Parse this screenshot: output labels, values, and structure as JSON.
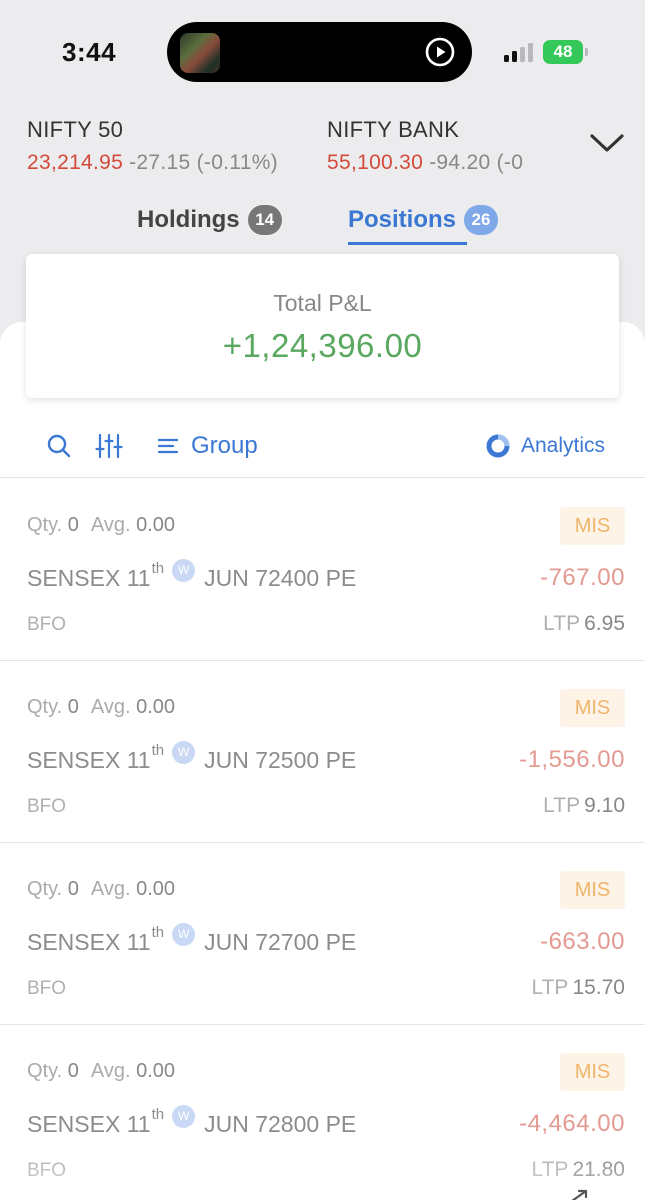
{
  "status_bar": {
    "time": "3:44",
    "battery": "48"
  },
  "indices": [
    {
      "name": "NIFTY 50",
      "price": "23,214.95",
      "change": "-27.15 (-0.11%)"
    },
    {
      "name": "NIFTY BANK",
      "price": "55,100.30",
      "change": "-94.20 (-0"
    }
  ],
  "tabs": [
    {
      "label": "Holdings",
      "count": "14",
      "active": false
    },
    {
      "label": "Positions",
      "count": "26",
      "active": true
    }
  ],
  "summary": {
    "label": "Total P&L",
    "value": "+1,24,396.00"
  },
  "toolbar": {
    "group_label": "Group",
    "analytics_label": "Analytics"
  },
  "labels": {
    "qty": "Qty.",
    "avg": "Avg.",
    "ltp": "LTP",
    "weekly": "W"
  },
  "positions": [
    {
      "qty": "0",
      "avg": "0.00",
      "product": "MIS",
      "symbol": "SENSEX 11",
      "ordinal": "th",
      "contract": "JUN 72400 PE",
      "pnl": "-767.00",
      "exchange": "BFO",
      "ltp": "6.95"
    },
    {
      "qty": "0",
      "avg": "0.00",
      "product": "MIS",
      "symbol": "SENSEX 11",
      "ordinal": "th",
      "contract": "JUN 72500 PE",
      "pnl": "-1,556.00",
      "exchange": "BFO",
      "ltp": "9.10"
    },
    {
      "qty": "0",
      "avg": "0.00",
      "product": "MIS",
      "symbol": "SENSEX 11",
      "ordinal": "th",
      "contract": "JUN 72700 PE",
      "pnl": "-663.00",
      "exchange": "BFO",
      "ltp": "15.70"
    },
    {
      "qty": "0",
      "avg": "0.00",
      "product": "MIS",
      "symbol": "SENSEX 11",
      "ordinal": "th",
      "contract": "JUN 72800 PE",
      "pnl": "-4,464.00",
      "exchange": "BFO",
      "ltp": "21.80"
    }
  ],
  "colors": {
    "accent": "#3a78d4",
    "loss": "#d3493a",
    "profit": "#5aa85f",
    "product_badge": "#f0b56b"
  },
  "icons": [
    "play-icon",
    "signal-icon",
    "chevron-down-icon",
    "search-icon",
    "filter-icon",
    "group-icon",
    "analytics-icon"
  ]
}
